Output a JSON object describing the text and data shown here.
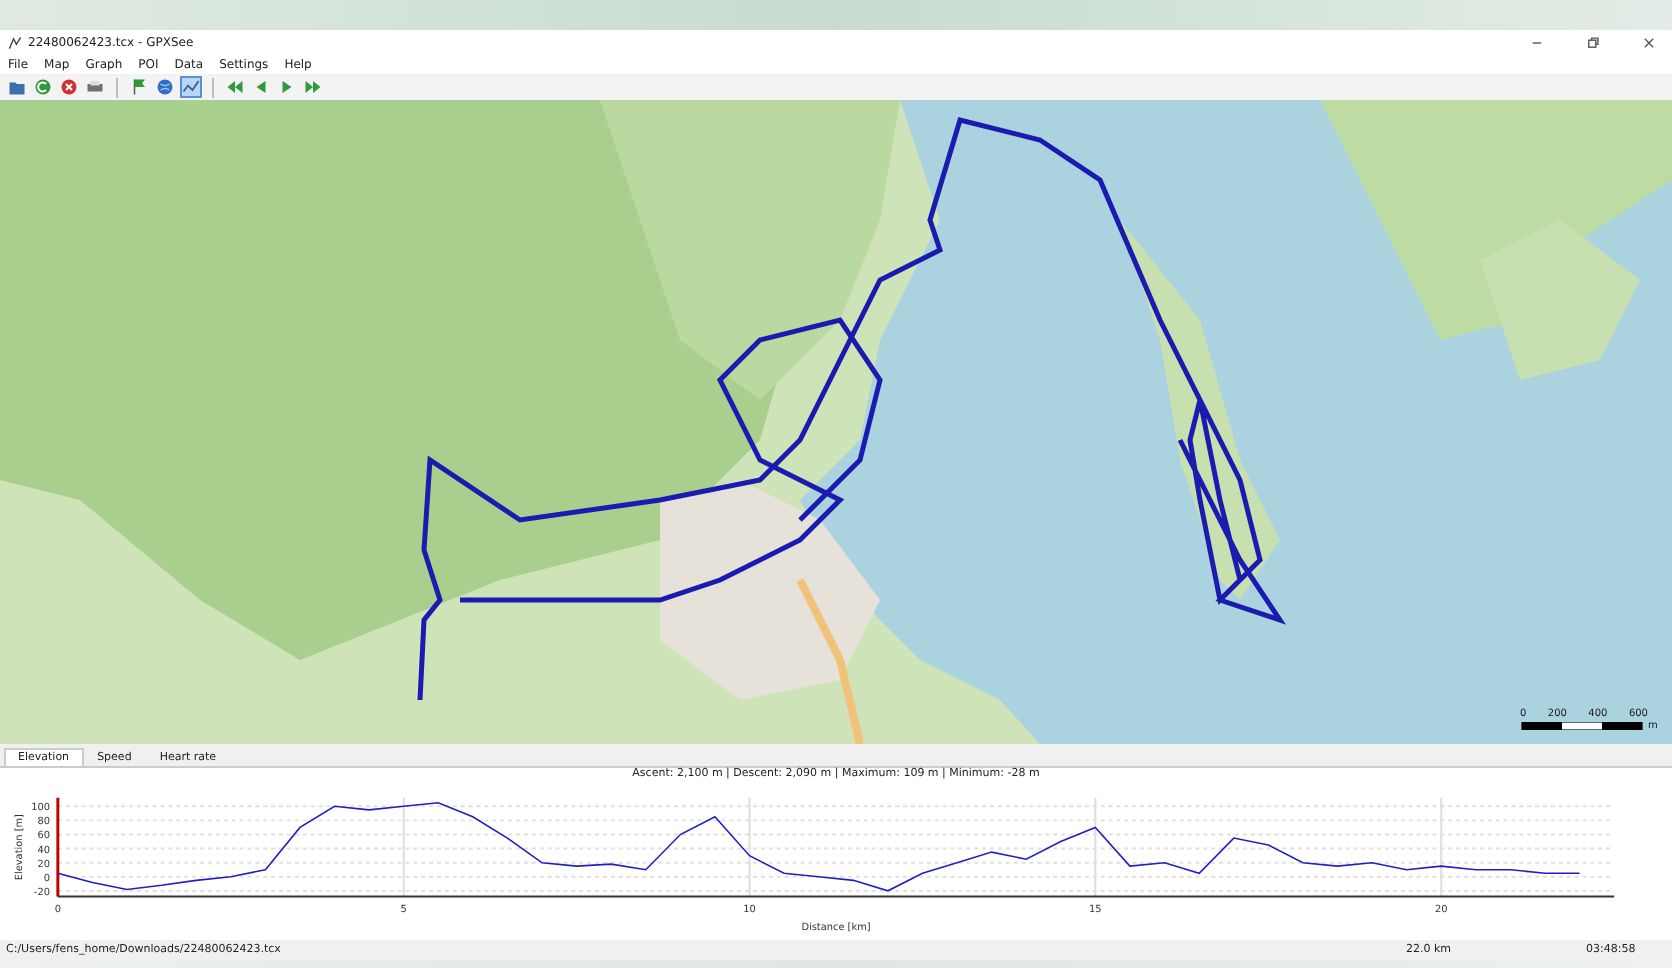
{
  "window": {
    "title": "22480062423.tcx - GPXSee"
  },
  "menu": [
    "File",
    "Map",
    "Graph",
    "POI",
    "Data",
    "Settings",
    "Help"
  ],
  "toolbar": [
    {
      "kind": "open",
      "selected": false
    },
    {
      "kind": "reload",
      "selected": false
    },
    {
      "kind": "close",
      "selected": false
    },
    {
      "kind": "print",
      "selected": false
    },
    {
      "kind": "sep"
    },
    {
      "kind": "flag",
      "selected": false
    },
    {
      "kind": "globe",
      "selected": false
    },
    {
      "kind": "graph",
      "selected": true
    },
    {
      "kind": "sep"
    },
    {
      "kind": "first",
      "selected": false
    },
    {
      "kind": "prev",
      "selected": false
    },
    {
      "kind": "next",
      "selected": false
    },
    {
      "kind": "last",
      "selected": false
    }
  ],
  "map": {
    "scale": {
      "labels": [
        "0",
        "200",
        "400",
        "600"
      ],
      "unit": "m"
    }
  },
  "graph_tabs": [
    {
      "label": "Elevation",
      "selected": true
    },
    {
      "label": "Speed",
      "selected": false
    },
    {
      "label": "Heart rate",
      "selected": false
    }
  ],
  "graph": {
    "info": "Ascent: 2,100 m | Descent: 2,090 m | Maximum: 109 m | Minimum: -28 m",
    "chart_data": {
      "type": "line",
      "xlabel": "Distance [km]",
      "ylabel": "Elevation [m]",
      "xlim": [
        0,
        22.5
      ],
      "ylim": [
        -28,
        112
      ],
      "xticks": [
        0,
        5,
        10,
        15,
        20
      ],
      "yticks": [
        -20,
        0,
        20,
        40,
        60,
        80,
        100
      ],
      "grid": true,
      "x": [
        0,
        0.5,
        1,
        1.5,
        2,
        2.5,
        3,
        3.5,
        4,
        4.5,
        5,
        5.5,
        6,
        6.5,
        7,
        7.5,
        8,
        8.5,
        9,
        9.5,
        10,
        10.5,
        11,
        11.5,
        12,
        12.5,
        13,
        13.5,
        14,
        14.5,
        15,
        15.5,
        16,
        16.5,
        17,
        17.5,
        18,
        18.5,
        19,
        19.5,
        20,
        20.5,
        21,
        21.5,
        22
      ],
      "series": [
        {
          "color": "#2020c0",
          "values": [
            5,
            -8,
            -18,
            -12,
            -5,
            0,
            10,
            70,
            100,
            95,
            100,
            105,
            85,
            55,
            20,
            15,
            18,
            10,
            60,
            85,
            30,
            5,
            0,
            -5,
            -20,
            5,
            20,
            35,
            25,
            50,
            70,
            15,
            20,
            5,
            55,
            45,
            20,
            15,
            20,
            10,
            15,
            10,
            10,
            5,
            5
          ]
        }
      ]
    }
  },
  "status_bar": {
    "path": "C:/Users/fens_home/Downloads/22480062423.tcx",
    "distance": "22.0 km",
    "time": "03:48:58"
  }
}
